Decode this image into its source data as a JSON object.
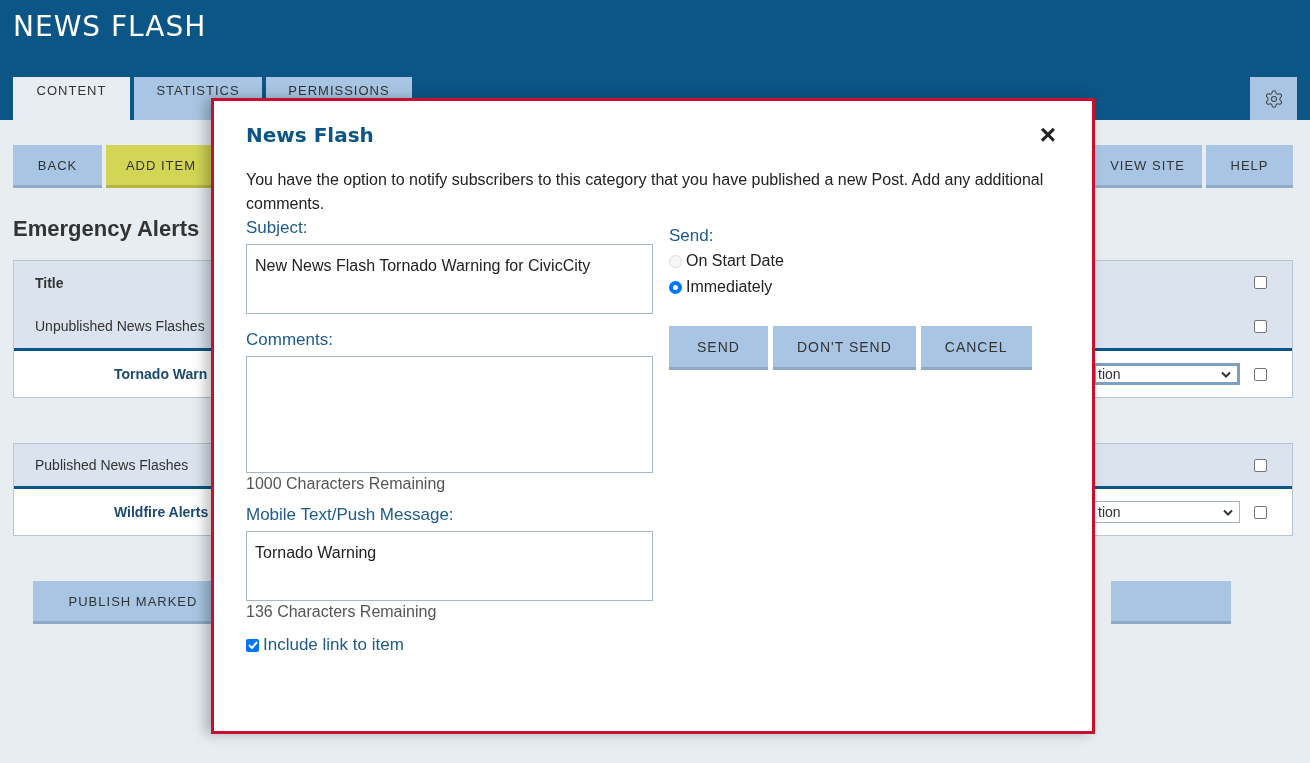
{
  "header": {
    "title": "NEWS FLASH"
  },
  "tabs": [
    {
      "label": "CONTENT",
      "selected": true
    },
    {
      "label": "STATISTICS",
      "selected": false
    },
    {
      "label": "PERMISSIONS",
      "selected": false
    }
  ],
  "toolbar_left": [
    {
      "label": "BACK",
      "kind": "default"
    },
    {
      "label": "ADD ITEM",
      "kind": "primary"
    }
  ],
  "toolbar_right": [
    {
      "label": "VIEW SITE"
    },
    {
      "label": "HELP"
    }
  ],
  "heading": "Emergency Alerts",
  "table": {
    "column_title": "Title",
    "header_checked": false,
    "groups": [
      {
        "label": "Unpublished News Flashes",
        "checked": false,
        "rows": [
          {
            "title": "Tornado Warn",
            "select": "tion",
            "focused": true,
            "checked": false
          }
        ]
      },
      {
        "label": "Published News Flashes",
        "checked": false,
        "rows": [
          {
            "title": "Wildfire Alerts",
            "select": "tion",
            "focused": false,
            "checked": false
          }
        ]
      }
    ]
  },
  "footer_buttons": [
    {
      "label": "PUBLISH MARKED"
    }
  ],
  "dialog": {
    "title": "News Flash",
    "close": "×",
    "intro": "You have the option to notify subscribers to this category that you have published a new Post. Add any additional comments.",
    "fields": [
      {
        "label": "Subject:",
        "value": "New News Flash Tornado Warning for CivicCity",
        "kind": "short"
      },
      {
        "label": "Comments:",
        "count": "1000 Characters Remaining",
        "kind": "tall"
      },
      {
        "label": "Mobile Text/Push Message:",
        "value": "Tornado Warning",
        "count": "136 Characters Remaining",
        "kind": "short"
      }
    ],
    "include_link": {
      "label": "Include link to item",
      "checked": true
    },
    "send_label": "Send:",
    "send_options": [
      {
        "label": "On Start Date",
        "selected": false,
        "disabled": true
      },
      {
        "label": "Immediately",
        "selected": true,
        "disabled": false
      }
    ],
    "buttons": [
      "SEND",
      "DON'T SEND",
      "CANCEL"
    ]
  }
}
